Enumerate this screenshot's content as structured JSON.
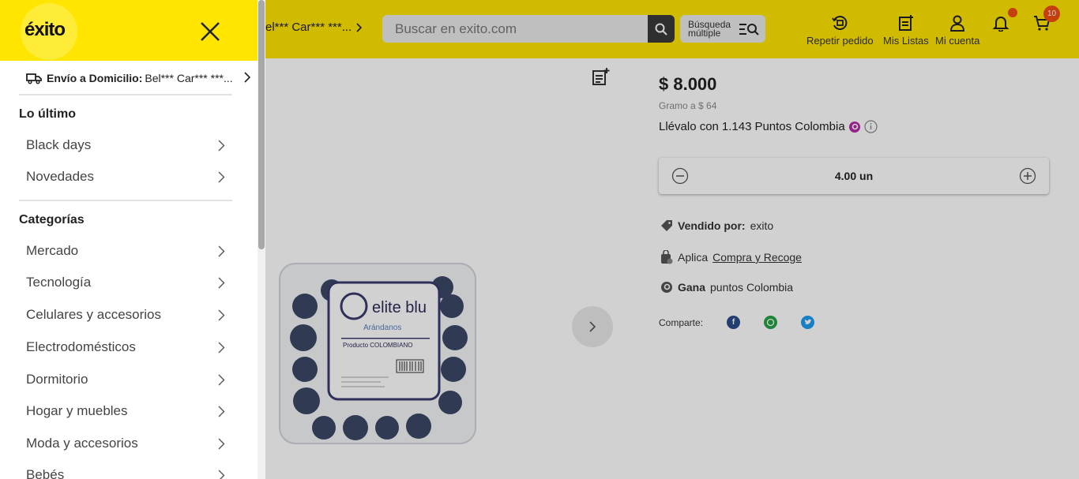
{
  "header": {
    "address_chip": "el*** Car*** ***...",
    "search_placeholder": "Buscar en exito.com",
    "multi_search_label": "Búsqueda múltiple",
    "actions": {
      "repeat_order": "Repetir pedido",
      "my_lists": "Mis Listas",
      "my_account": "Mi cuenta"
    },
    "cart_count": "10"
  },
  "product": {
    "price": "$ 8.000",
    "unit_price": "Gramo a $ 64",
    "points_prefix": "Llévalo con",
    "points_value": "1.143",
    "points_suffix": "Puntos Colombia",
    "quantity": "4.00 un",
    "sold_by_label": "Vendido por:",
    "sold_by_value": "exito",
    "applies_label": "Aplica",
    "applies_link": "Compra y Recoge",
    "earn_label": "Gana",
    "earn_value": "puntos Colombia",
    "share_label": "Comparte:",
    "package_brand": "elite blu",
    "package_subtitle": "Arándanos",
    "package_product": "Producto COLOMBIANO"
  },
  "drawer": {
    "logo": "éxito",
    "delivery_label": "Envío a Domicilio:",
    "delivery_value": "Bel*** Car*** ***...",
    "section_latest": "Lo último",
    "latest_items": [
      "Black days",
      "Novedades"
    ],
    "section_categories": "Categorías",
    "categories": [
      "Mercado",
      "Tecnología",
      "Celulares y accesorios",
      "Electrodomésticos",
      "Dormitorio",
      "Hogar y muebles",
      "Moda y accesorios",
      "Bebés"
    ]
  },
  "colors": {
    "brand_yellow": "#ffe500",
    "badge_orange": "#f04e0f",
    "facebook": "#2b4d8c",
    "whatsapp": "#25a244",
    "twitter": "#1d9bf0"
  }
}
